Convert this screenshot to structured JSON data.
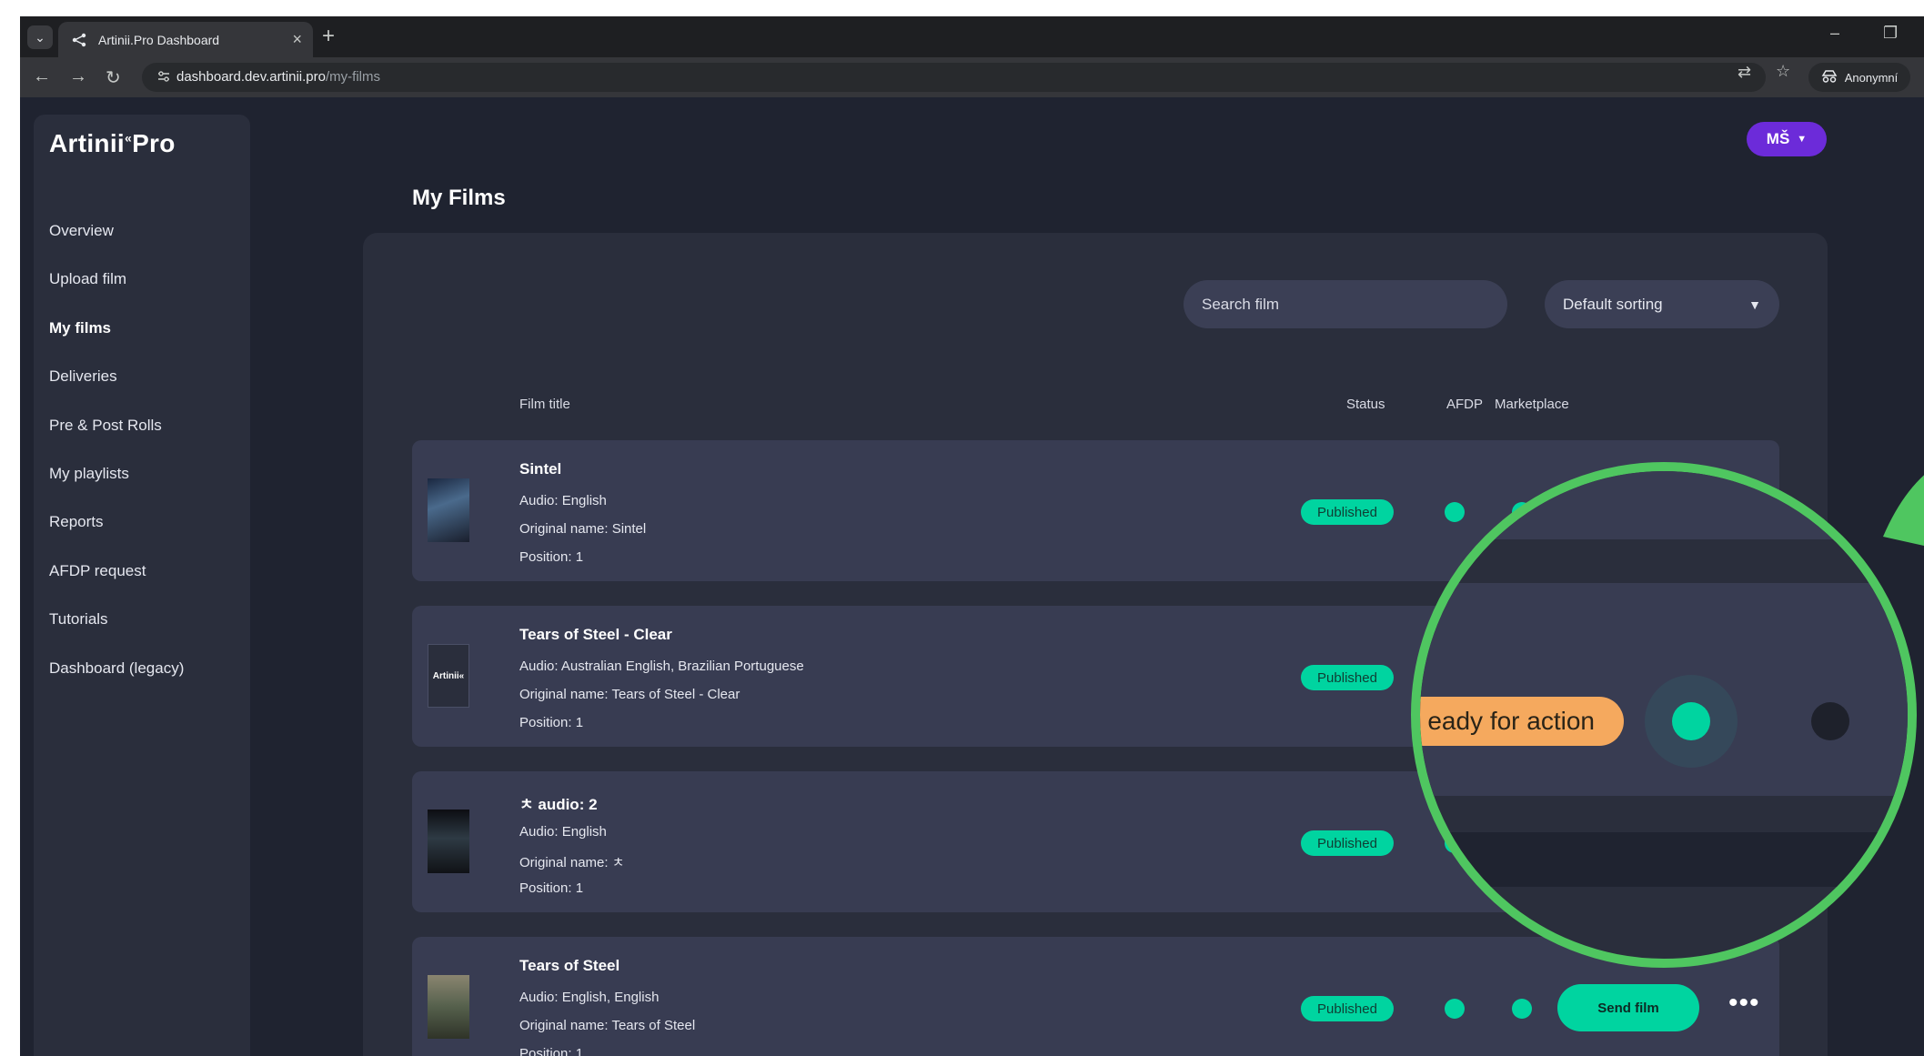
{
  "browser": {
    "tab_title": "Artinii.Pro Dashboard",
    "url_host": "dashboard.dev.artinii.pro",
    "url_path": "/my-films",
    "incognito_label": "Anonymní"
  },
  "app": {
    "logo": "Artinii",
    "logo_mark": "«",
    "logo_suffix": "Pro",
    "user_initials": "MŠ",
    "page_title": "My Films"
  },
  "sidebar": {
    "items": [
      {
        "label": "Overview",
        "active": false
      },
      {
        "label": "Upload film",
        "active": false
      },
      {
        "label": "My films",
        "active": true
      },
      {
        "label": "Deliveries",
        "active": false
      },
      {
        "label": "Pre & Post Rolls",
        "active": false
      },
      {
        "label": "My playlists",
        "active": false
      },
      {
        "label": "Reports",
        "active": false
      },
      {
        "label": "AFDP request",
        "active": false
      },
      {
        "label": "Tutorials",
        "active": false
      },
      {
        "label": "Dashboard (legacy)",
        "active": false
      }
    ]
  },
  "filters": {
    "search_placeholder": "Search film",
    "sort_value": "Default sorting"
  },
  "table": {
    "headers": {
      "title": "Film title",
      "status": "Status",
      "afdp": "AFDP",
      "marketplace": "Marketplace"
    },
    "rows": [
      {
        "title": "Sintel",
        "audio": "Audio: English",
        "original": "Original name: Sintel",
        "position": "Position: 1",
        "status": "Published"
      },
      {
        "title": "Tears of Steel - Clear",
        "audio": "Audio: Australian English, Brazilian Portuguese",
        "original": "Original name: Tears of Steel - Clear",
        "position": "Position: 1",
        "status": "Published",
        "poster_text": "Artinii«"
      },
      {
        "title": "ㅊ audio: 2",
        "audio": "Audio: English",
        "original": "Original name: ㅊ",
        "position": "Position: 1",
        "status": "Published"
      },
      {
        "title": "Tears of Steel",
        "audio": "Audio: English, English",
        "original": "Original name: Tears of Steel",
        "position": "Position: 1",
        "status": "Published",
        "action": "Send film"
      }
    ]
  },
  "magnifier": {
    "pill_text": "eady for action"
  },
  "colors": {
    "accent_green": "#00d4a0",
    "avatar_purple": "#6c2bd9",
    "magnifier_ring": "#4fc660",
    "pill_orange": "#f5a95e"
  }
}
